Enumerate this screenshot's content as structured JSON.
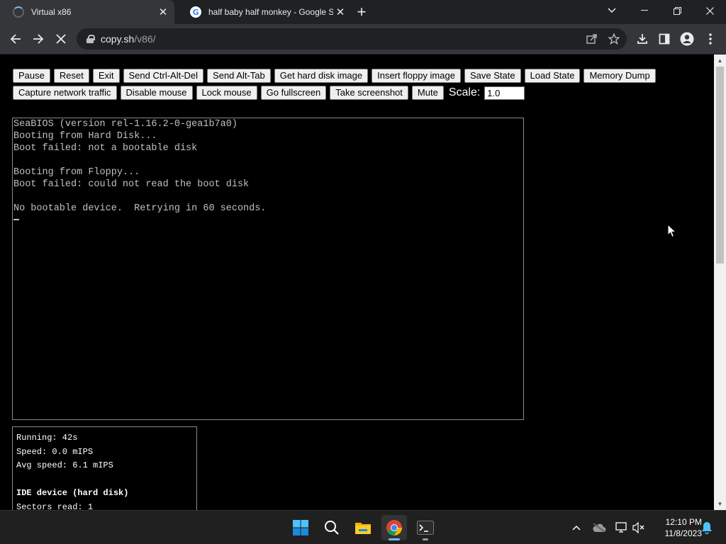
{
  "browser": {
    "tabs": [
      {
        "title": "Virtual x86",
        "active": true,
        "favicon": "loading-spinner-icon"
      },
      {
        "title": "half baby half monkey - Google S",
        "active": false,
        "favicon": "google-g-icon"
      }
    ],
    "url_host": "copy.sh",
    "url_path": "/v86/"
  },
  "controls": {
    "row1": [
      "Pause",
      "Reset",
      "Exit",
      "Send Ctrl-Alt-Del",
      "Send Alt-Tab",
      "Get hard disk image",
      "Insert floppy image",
      "Save State",
      "Load State",
      "Memory Dump"
    ],
    "row2": [
      "Capture network traffic",
      "Disable mouse",
      "Lock mouse",
      "Go fullscreen",
      "Take screenshot",
      "Mute"
    ],
    "scale_label": "Scale:",
    "scale_value": "1.0"
  },
  "screen": {
    "lines": [
      "SeaBIOS (version rel-1.16.2-0-gea1b7a0)",
      "Booting from Hard Disk...",
      "Boot failed: not a bootable disk",
      "",
      "Booting from Floppy...",
      "Boot failed: could not read the boot disk",
      "",
      "No bootable device.  Retrying in 60 seconds."
    ]
  },
  "stats": {
    "running": "Running: 42s",
    "speed": "Speed: 0.0 mIPS",
    "avg_speed": "Avg speed: 6.1 mIPS",
    "ide_header": "IDE device (hard disk)",
    "sectors_read": "Sectors read: 1"
  },
  "taskbar": {
    "apps": [
      "start-icon",
      "search-icon",
      "file-explorer-icon",
      "chrome-icon",
      "terminal-icon"
    ],
    "time": "12:10 PM",
    "date": "11/8/2023"
  },
  "colors": {
    "chrome_dark": "#202124",
    "chrome_toolbar": "#35363a",
    "terminal_text": "#c0c0c0",
    "accent": "#76b9ed"
  }
}
